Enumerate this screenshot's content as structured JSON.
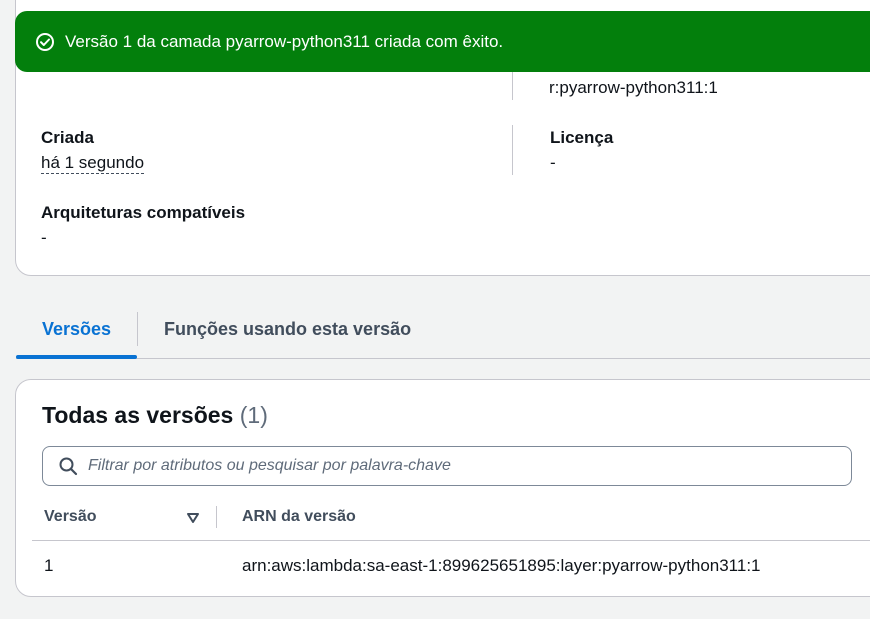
{
  "flash": {
    "message": "Versão 1 da camada pyarrow-python311 criada com êxito.",
    "icon": "check-circle-icon",
    "color": "#037f0c"
  },
  "details": {
    "arn_fragment": "r:pyarrow-python311:1",
    "created": {
      "label": "Criada",
      "value": "há 1 segundo"
    },
    "license": {
      "label": "Licença",
      "value": "-"
    },
    "architectures": {
      "label": "Arquiteturas compatíveis",
      "value": "-"
    }
  },
  "tabs": [
    {
      "label": "Versões",
      "active": true
    },
    {
      "label": "Funções usando esta versão",
      "active": false
    }
  ],
  "versions": {
    "title": "Todas as versões",
    "count": "(1)",
    "search_placeholder": "Filtrar por atributos ou pesquisar por palavra-chave",
    "columns": [
      "Versão",
      "ARN da versão"
    ],
    "rows": [
      {
        "version": "1",
        "arn": "arn:aws:lambda:sa-east-1:899625651895:layer:pyarrow-python311:1"
      }
    ]
  },
  "colors": {
    "accent": "#0972d3",
    "success": "#037f0c"
  }
}
